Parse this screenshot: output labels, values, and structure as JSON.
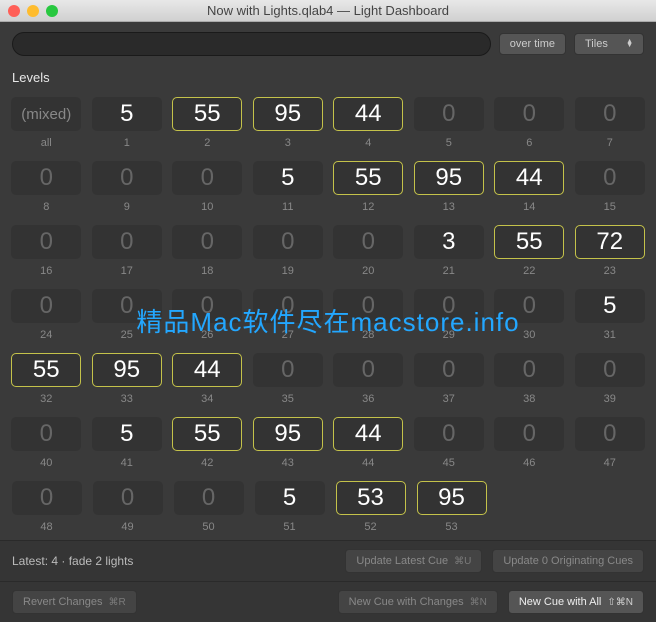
{
  "window": {
    "title": "Now with Lights.qlab4 — Light Dashboard"
  },
  "toolbar": {
    "search_placeholder": "",
    "overtime_label": "over time",
    "view_mode": "Tiles"
  },
  "section": {
    "title": "Levels"
  },
  "cells": [
    [
      {
        "label": "all",
        "value": "(mixed)",
        "active": false,
        "hl": false,
        "mixed": true
      },
      {
        "label": "1",
        "value": "5",
        "active": true,
        "hl": false
      },
      {
        "label": "2",
        "value": "55",
        "active": true,
        "hl": true
      },
      {
        "label": "3",
        "value": "95",
        "active": true,
        "hl": true
      },
      {
        "label": "4",
        "value": "44",
        "active": true,
        "hl": true
      },
      {
        "label": "5",
        "value": "0",
        "active": false,
        "hl": false
      },
      {
        "label": "6",
        "value": "0",
        "active": false,
        "hl": false
      },
      {
        "label": "7",
        "value": "0",
        "active": false,
        "hl": false
      }
    ],
    [
      {
        "label": "8",
        "value": "0",
        "active": false,
        "hl": false
      },
      {
        "label": "9",
        "value": "0",
        "active": false,
        "hl": false
      },
      {
        "label": "10",
        "value": "0",
        "active": false,
        "hl": false
      },
      {
        "label": "11",
        "value": "5",
        "active": true,
        "hl": false
      },
      {
        "label": "12",
        "value": "55",
        "active": true,
        "hl": true
      },
      {
        "label": "13",
        "value": "95",
        "active": true,
        "hl": true
      },
      {
        "label": "14",
        "value": "44",
        "active": true,
        "hl": true
      },
      {
        "label": "15",
        "value": "0",
        "active": false,
        "hl": false
      }
    ],
    [
      {
        "label": "16",
        "value": "0",
        "active": false,
        "hl": false
      },
      {
        "label": "17",
        "value": "0",
        "active": false,
        "hl": false
      },
      {
        "label": "18",
        "value": "0",
        "active": false,
        "hl": false
      },
      {
        "label": "19",
        "value": "0",
        "active": false,
        "hl": false
      },
      {
        "label": "20",
        "value": "0",
        "active": false,
        "hl": false
      },
      {
        "label": "21",
        "value": "3",
        "active": true,
        "hl": false
      },
      {
        "label": "22",
        "value": "55",
        "active": true,
        "hl": true
      },
      {
        "label": "23",
        "value": "72",
        "active": true,
        "hl": true
      }
    ],
    [
      {
        "label": "24",
        "value": "0",
        "active": false,
        "hl": false
      },
      {
        "label": "25",
        "value": "0",
        "active": false,
        "hl": false
      },
      {
        "label": "26",
        "value": "0",
        "active": false,
        "hl": false
      },
      {
        "label": "27",
        "value": "0",
        "active": false,
        "hl": false
      },
      {
        "label": "28",
        "value": "0",
        "active": false,
        "hl": false
      },
      {
        "label": "29",
        "value": "0",
        "active": false,
        "hl": false
      },
      {
        "label": "30",
        "value": "0",
        "active": false,
        "hl": false
      },
      {
        "label": "31",
        "value": "5",
        "active": true,
        "hl": false
      }
    ],
    [
      {
        "label": "32",
        "value": "55",
        "active": true,
        "hl": true
      },
      {
        "label": "33",
        "value": "95",
        "active": true,
        "hl": true
      },
      {
        "label": "34",
        "value": "44",
        "active": true,
        "hl": true
      },
      {
        "label": "35",
        "value": "0",
        "active": false,
        "hl": false
      },
      {
        "label": "36",
        "value": "0",
        "active": false,
        "hl": false
      },
      {
        "label": "37",
        "value": "0",
        "active": false,
        "hl": false
      },
      {
        "label": "38",
        "value": "0",
        "active": false,
        "hl": false
      },
      {
        "label": "39",
        "value": "0",
        "active": false,
        "hl": false
      }
    ],
    [
      {
        "label": "40",
        "value": "0",
        "active": false,
        "hl": false
      },
      {
        "label": "41",
        "value": "5",
        "active": true,
        "hl": false
      },
      {
        "label": "42",
        "value": "55",
        "active": true,
        "hl": true
      },
      {
        "label": "43",
        "value": "95",
        "active": true,
        "hl": true
      },
      {
        "label": "44",
        "value": "44",
        "active": true,
        "hl": true
      },
      {
        "label": "45",
        "value": "0",
        "active": false,
        "hl": false
      },
      {
        "label": "46",
        "value": "0",
        "active": false,
        "hl": false
      },
      {
        "label": "47",
        "value": "0",
        "active": false,
        "hl": false
      }
    ],
    [
      {
        "label": "48",
        "value": "0",
        "active": false,
        "hl": false
      },
      {
        "label": "49",
        "value": "0",
        "active": false,
        "hl": false
      },
      {
        "label": "50",
        "value": "0",
        "active": false,
        "hl": false
      },
      {
        "label": "51",
        "value": "5",
        "active": true,
        "hl": false
      },
      {
        "label": "52",
        "value": "53",
        "active": true,
        "hl": true
      },
      {
        "label": "53",
        "value": "95",
        "active": true,
        "hl": true
      }
    ]
  ],
  "watermark": "精品Mac软件尽在macstore.info",
  "footer": {
    "latest_text": "Latest: 4 · fade 2 lights",
    "update_latest": "Update Latest Cue",
    "update_latest_key": "⌘U",
    "update_orig": "Update 0 Originating Cues",
    "revert": "Revert Changes",
    "revert_key": "⌘R",
    "new_cue_changes": "New Cue with Changes",
    "new_cue_changes_key": "⌘N",
    "new_cue_all": "New Cue with All",
    "new_cue_all_key": "⇧⌘N"
  }
}
